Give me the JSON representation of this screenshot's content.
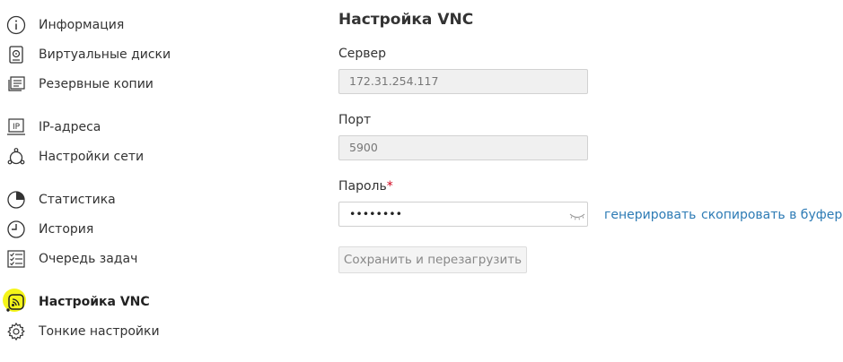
{
  "sidebar": {
    "items": [
      {
        "label": "Информация",
        "icon": "info-icon"
      },
      {
        "label": "Виртуальные диски",
        "icon": "disk-icon"
      },
      {
        "label": "Резервные копии",
        "icon": "backup-icon"
      },
      {
        "label": "IP-адреса",
        "icon": "ip-icon"
      },
      {
        "label": "Настройки сети",
        "icon": "network-icon"
      },
      {
        "label": "Статистика",
        "icon": "pie-chart-icon"
      },
      {
        "label": "История",
        "icon": "clock-icon"
      },
      {
        "label": "Очередь задач",
        "icon": "task-list-icon"
      },
      {
        "label": "Настройка VNC",
        "icon": "vnc-icon",
        "active": true
      },
      {
        "label": "Тонкие настройки",
        "icon": "gear-icon"
      }
    ]
  },
  "form": {
    "title": "Настройка VNC",
    "server": {
      "label": "Сервер",
      "value": "172.31.254.117"
    },
    "port": {
      "label": "Порт",
      "value": "5900"
    },
    "password": {
      "label": "Пароль",
      "required_mark": "*",
      "value": "••••••••"
    },
    "generate_link": "генерировать",
    "copy_link": "скопировать в буфер",
    "save_button": "Сохранить и перезагрузить"
  },
  "colors": {
    "link": "#2d7bb5",
    "required": "#d0021b",
    "highlight": "#f4f400"
  }
}
